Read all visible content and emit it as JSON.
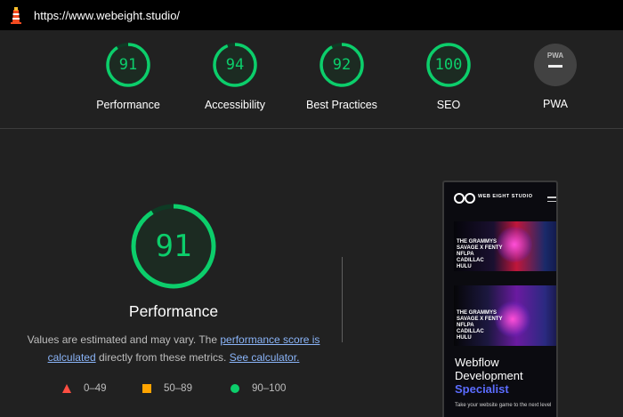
{
  "browser": {
    "url": "https://www.webeight.studio/"
  },
  "summary": {
    "categories": [
      {
        "label": "Performance",
        "score": "91"
      },
      {
        "label": "Accessibility",
        "score": "94"
      },
      {
        "label": "Best Practices",
        "score": "92"
      },
      {
        "label": "SEO",
        "score": "100"
      }
    ],
    "pwa": {
      "label": "PWA",
      "badge_text": "PWA"
    }
  },
  "detail": {
    "score": "91",
    "title": "Performance",
    "note_prefix": "Values are estimated and may vary. The ",
    "note_link1": "performance score is calculated",
    "note_mid": " directly from these metrics. ",
    "note_link2": "See calculator."
  },
  "legend": [
    {
      "range": "0–49",
      "color": "#ff4e42",
      "icon": "triangle-icon"
    },
    {
      "range": "50–89",
      "color": "#ffa400",
      "icon": "square-icon"
    },
    {
      "range": "90–100",
      "color": "#0cce6b",
      "icon": "circle-icon"
    }
  ],
  "screenshot": {
    "brand": "WEB EIGHT STUDIO",
    "card1_lines": [
      "THE GRAMMYS",
      "SAVAGE X FENTY",
      "NFLPA",
      "CADILLAC",
      "HULU"
    ],
    "card2_lines": [
      "THE GRAMMYS",
      "SAVAGE X FENTY",
      "NFLPA",
      "CADILLAC",
      "HULU"
    ],
    "headline_line1": "Webflow",
    "headline_line2": "Development",
    "headline_accent": "Specialist",
    "footer": "Take your website game to the next level"
  },
  "colors": {
    "pass": "#0cce6b",
    "average": "#ffa400",
    "fail": "#ff4e42",
    "link": "#8ab4f8"
  }
}
